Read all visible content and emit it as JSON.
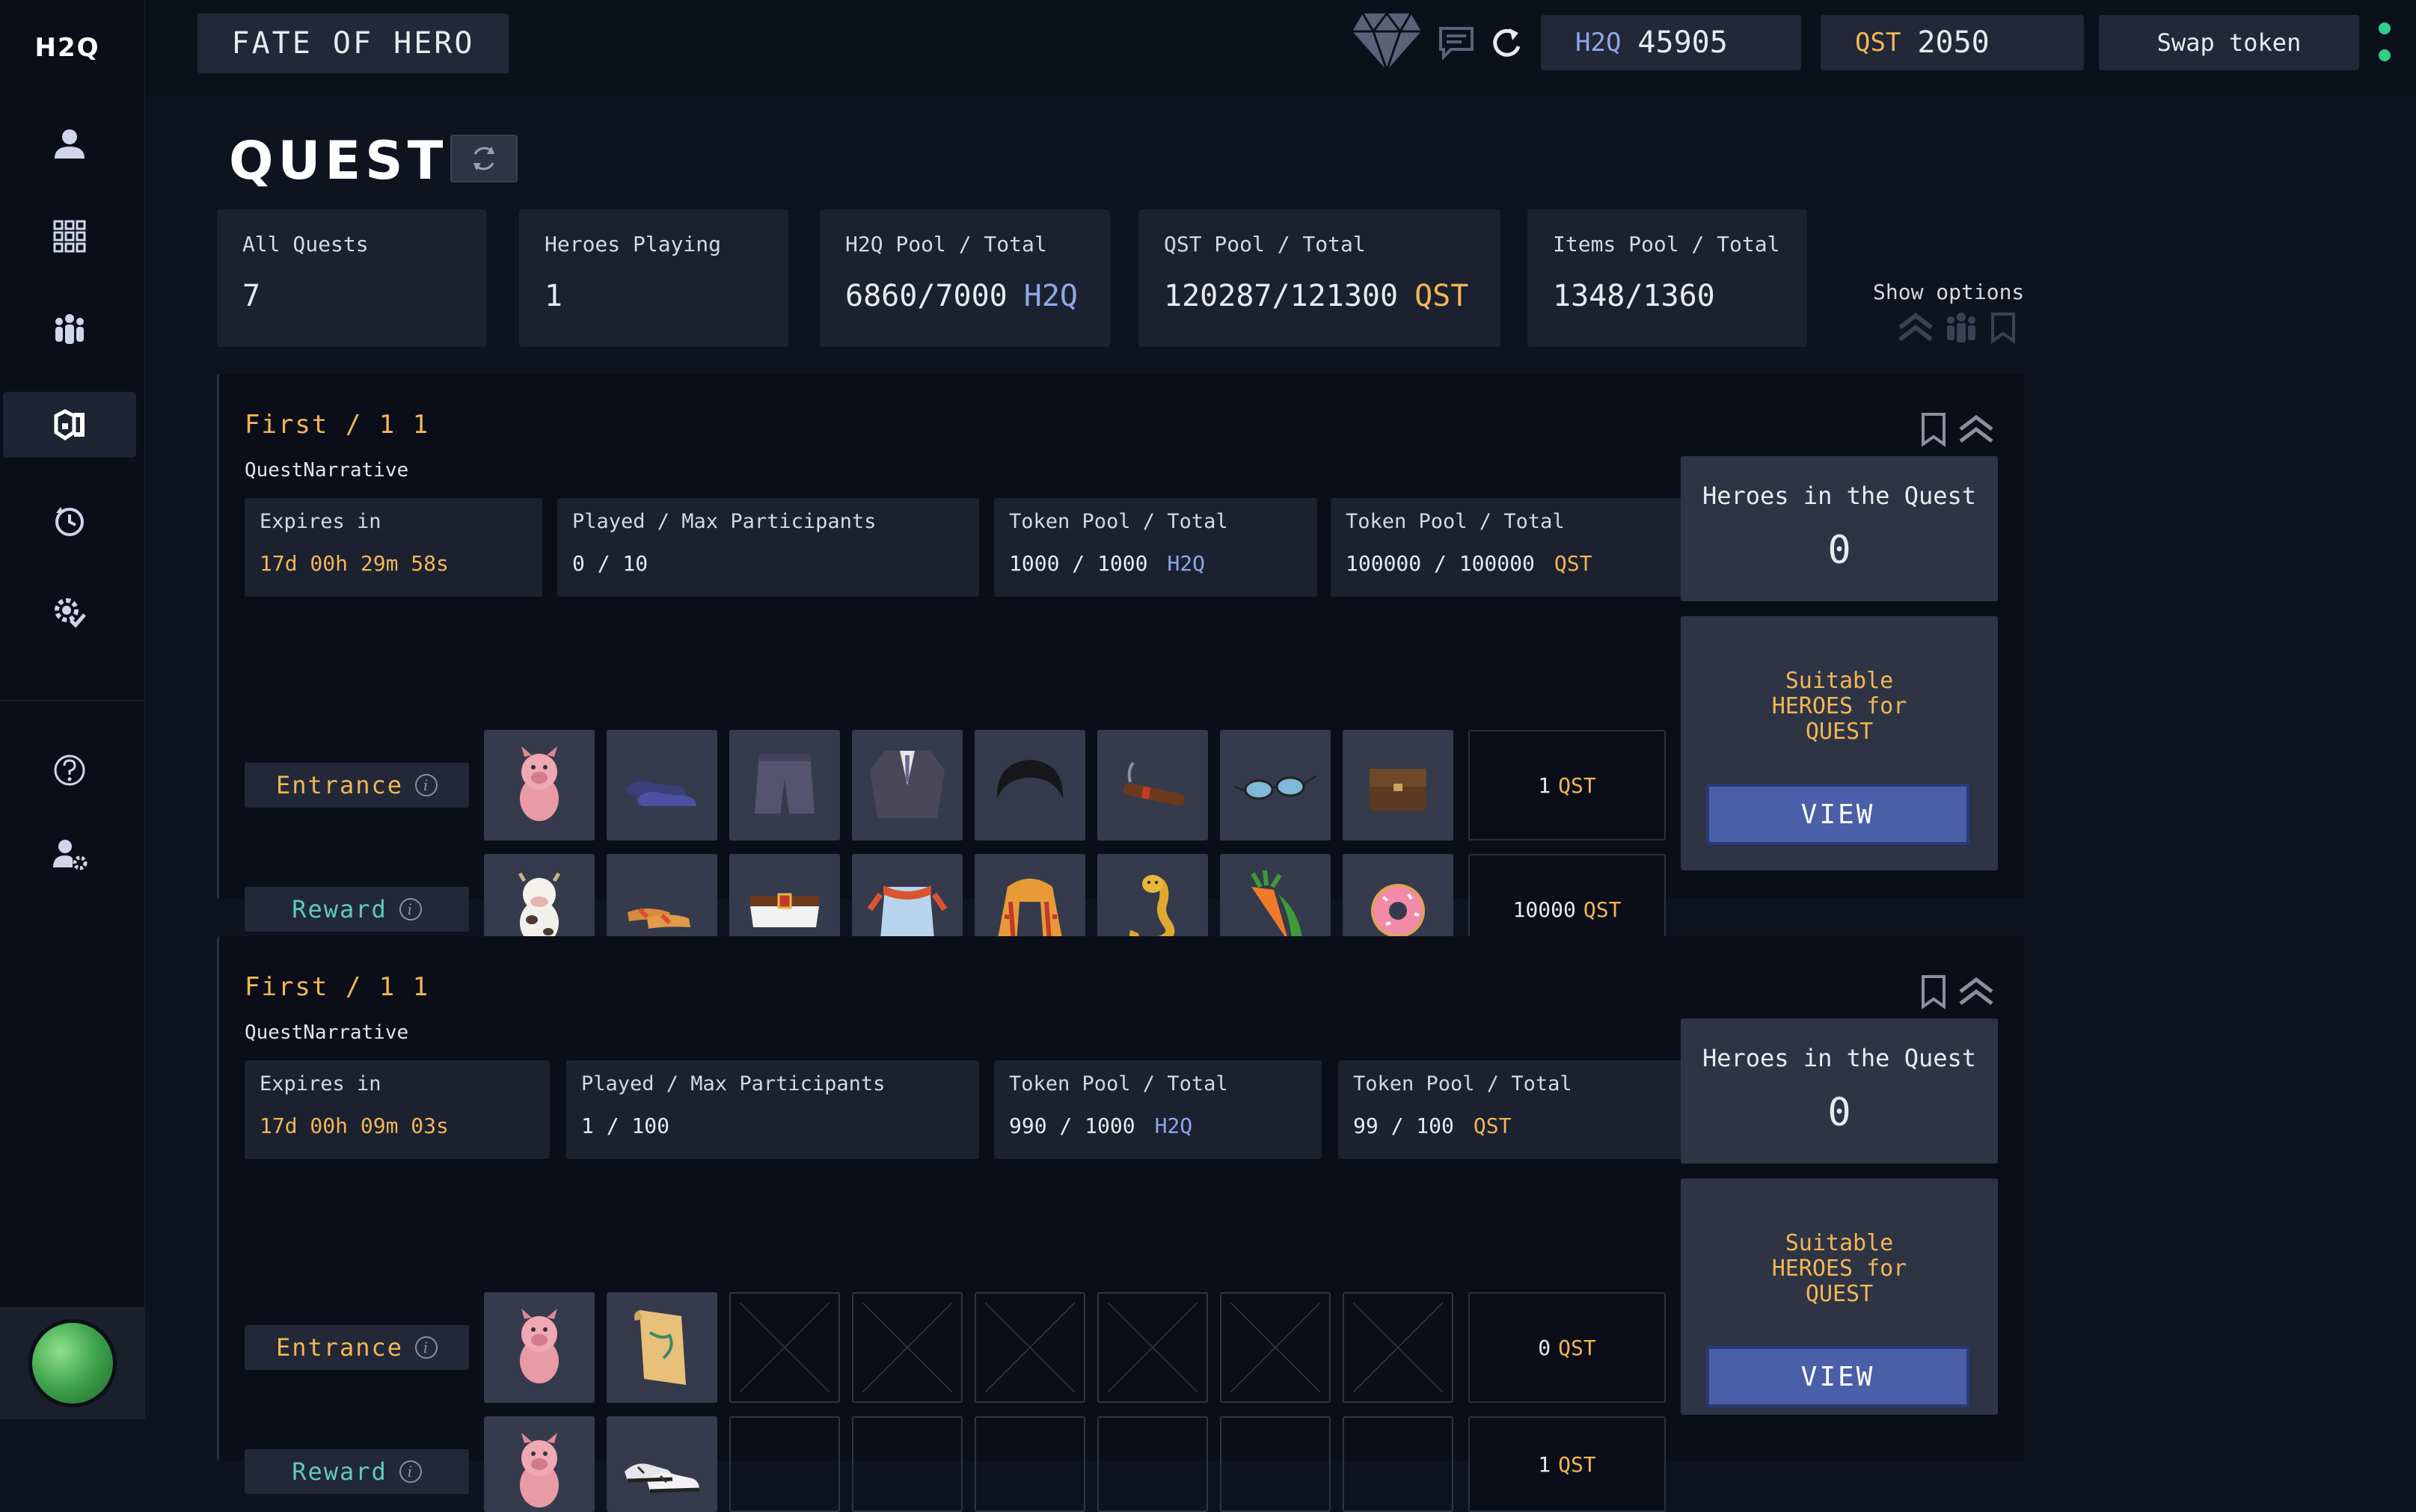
{
  "app": {
    "logo": "H2Q",
    "title": "FATE OF HERO"
  },
  "topbar": {
    "h2q": {
      "name": "H2Q",
      "value": "45905",
      "color": "#8fa6e8"
    },
    "qst": {
      "name": "QST",
      "value": "2050",
      "color": "#f2b656"
    },
    "swap_label": "Swap token"
  },
  "page": {
    "title": "QUEST",
    "show_options": "Show options"
  },
  "stats": {
    "all_quests": {
      "label": "All Quests",
      "value": "7"
    },
    "heroes_playing": {
      "label": "Heroes Playing",
      "value": "1"
    },
    "h2q_pool": {
      "label": "H2Q Pool / Total",
      "value": "6860/7000",
      "unit": "H2Q"
    },
    "qst_pool": {
      "label": "QST Pool / Total",
      "value": "120287/121300",
      "unit": "QST"
    },
    "items_pool": {
      "label": "Items Pool / Total",
      "value": "1348/1360"
    }
  },
  "labels": {
    "expires": "Expires in",
    "played": "Played / Max Participants",
    "token_pool": "Token Pool / Total",
    "entrance": "Entrance",
    "reward": "Reward",
    "heroes_in_quest": "Heroes in the Quest",
    "suitable": "Suitable HEROES for QUEST",
    "view": "VIEW",
    "h2q": "H2Q",
    "qst": "QST"
  },
  "quests": [
    {
      "title": "First / 1 1",
      "narrative": "QuestNarrative",
      "expires": "17d 00h 29m 58s",
      "played": "0 / 10",
      "h2q_pool": "1000 / 1000",
      "qst_pool": "100000 / 100000",
      "entrance_tokens": "1",
      "reward_tokens": "10000",
      "heroes_in_quest": "0",
      "entrance_items": [
        "pig-item-icon",
        "dress-shoes-item-icon",
        "shorts-item-icon",
        "suit-jacket-item-icon",
        "hair-wig-item-icon",
        "cigar-item-icon",
        "glasses-item-icon",
        "satchel-item-icon"
      ],
      "reward_items": [
        "cow-item-icon",
        "sandals-item-icon",
        "belt-item-icon",
        "bib-top-item-icon",
        "pharaoh-headdress-item-icon",
        "cobra-item-icon",
        "carrots-item-icon",
        "donut-item-icon"
      ]
    },
    {
      "title": "First / 1 1",
      "narrative": "QuestNarrative",
      "expires": "17d 00h 09m 03s",
      "played": "1 / 100",
      "h2q_pool": "990 / 1000",
      "qst_pool": "99 / 100",
      "entrance_tokens": "0",
      "reward_tokens": "1",
      "heroes_in_quest": "0",
      "entrance_items": [
        "pig-item-icon",
        "treasure-map-item-icon"
      ],
      "reward_items": [
        "pig-item-icon",
        "sneakers-item-icon"
      ]
    }
  ]
}
